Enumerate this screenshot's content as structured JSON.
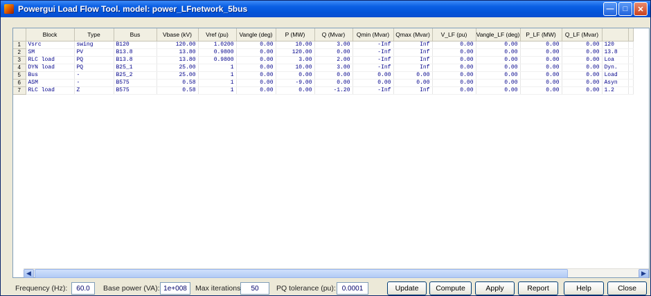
{
  "window": {
    "title": "Powergui Load Flow Tool. model: power_LFnetwork_5bus"
  },
  "grid": {
    "columns": [
      "Block",
      "Type",
      "Bus",
      "Vbase (kV)",
      "Vref (pu)",
      "Vangle (deg)",
      "P (MW)",
      "Q (Mvar)",
      "Qmin (Mvar)",
      "Qmax (Mvar)",
      "V_LF (pu)",
      "Vangle_LF (deg)",
      "P_LF (MW)",
      "Q_LF (Mvar)",
      ""
    ],
    "rows": [
      {
        "n": "1",
        "cells": [
          "Vsrc",
          "swing",
          "B120",
          "120.00",
          "1.0200",
          "0.00",
          "10.00",
          "3.00",
          "-Inf",
          "Inf",
          "0.00",
          "0.00",
          "0.00",
          "0.00",
          "120"
        ]
      },
      {
        "n": "2",
        "cells": [
          "SM",
          "PV",
          "B13.8",
          "13.80",
          "0.9800",
          "0.00",
          "120.00",
          "0.00",
          "-Inf",
          "Inf",
          "0.00",
          "0.00",
          "0.00",
          "0.00",
          "13.8"
        ]
      },
      {
        "n": "3",
        "cells": [
          "RLC load",
          "PQ",
          "B13.8",
          "13.80",
          "0.9800",
          "0.00",
          "3.00",
          "2.00",
          "-Inf",
          "Inf",
          "0.00",
          "0.00",
          "0.00",
          "0.00",
          "Loa"
        ]
      },
      {
        "n": "4",
        "cells": [
          "DYN load",
          "PQ",
          "B25_1",
          "25.00",
          "1",
          "0.00",
          "10.00",
          "3.00",
          "-Inf",
          "Inf",
          "0.00",
          "0.00",
          "0.00",
          "0.00",
          "Dyn."
        ]
      },
      {
        "n": "5",
        "cells": [
          "Bus",
          "-",
          "B25_2",
          "25.00",
          "1",
          "0.00",
          "0.00",
          "0.00",
          "0.00",
          "0.00",
          "0.00",
          "0.00",
          "0.00",
          "0.00",
          "Load"
        ]
      },
      {
        "n": "6",
        "cells": [
          "ASM",
          "-",
          "B575",
          "0.58",
          "1",
          "0.00",
          "-9.00",
          "0.00",
          "0.00",
          "0.00",
          "0.00",
          "0.00",
          "0.00",
          "0.00",
          "Asyn"
        ]
      },
      {
        "n": "7",
        "cells": [
          "RLC load",
          "Z",
          "B575",
          "0.58",
          "1",
          "0.00",
          "0.00",
          "-1.20",
          "-Inf",
          "Inf",
          "0.00",
          "0.00",
          "0.00",
          "0.00",
          "1.2"
        ]
      }
    ]
  },
  "controls": {
    "frequency_label": "Frequency (Hz):",
    "frequency_value": "60.0",
    "base_power_label": "Base power (VA):",
    "base_power_value": "1e+008",
    "max_iter_label": "Max iterations:",
    "max_iter_value": "50",
    "pq_tol_label": "PQ tolerance (pu):",
    "pq_tol_value": "0.0001",
    "update_label": "Update",
    "compute_label": "Compute",
    "apply_label": "Apply",
    "report_label": "Report",
    "help_label": "Help",
    "close_label": "Close"
  }
}
